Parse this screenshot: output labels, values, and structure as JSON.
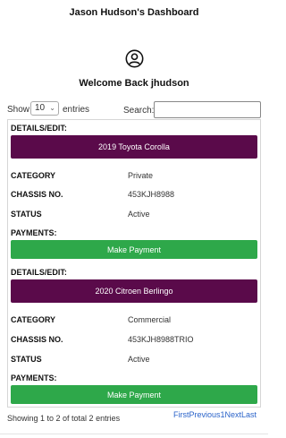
{
  "header": {
    "title": "Jason Hudson's Dashboard"
  },
  "user": {
    "avatar_icon": "user-circle-icon",
    "welcome": "Welcome Back jhudson"
  },
  "table_controls": {
    "show_label": "Show",
    "page_size": "10",
    "entries_label": "entries",
    "search_label": "Search:"
  },
  "records": [
    {
      "details_label": "DETAILS/EDIT:",
      "vehicle": "2019 Toyota Corolla",
      "category_label": "CATEGORY",
      "category": "Private",
      "chassis_label": "CHASSIS NO.",
      "chassis": "453KJH8988",
      "status_label": "STATUS",
      "status": "Active",
      "payments_label": "PAYMENTS:",
      "pay_button": "Make Payment"
    },
    {
      "details_label": "DETAILS/EDIT:",
      "vehicle": "2020 Citroen Berlingo",
      "category_label": "CATEGORY",
      "category": "Commercial",
      "chassis_label": "CHASSIS NO.",
      "chassis": "453KJH8988TRIO",
      "status_label": "STATUS",
      "status": "Active",
      "payments_label": "PAYMENTS:",
      "pay_button": "Make Payment"
    }
  ],
  "footer": {
    "info": "Showing 1 to 2 of total 2 entries",
    "pager": {
      "first": "First",
      "previous": "Previous",
      "current": "1",
      "next": "Next",
      "last": "Last"
    }
  },
  "colors": {
    "vehicle_button": "#5a0a4a",
    "pay_button": "#2ea84a",
    "link": "#2a63c9"
  }
}
